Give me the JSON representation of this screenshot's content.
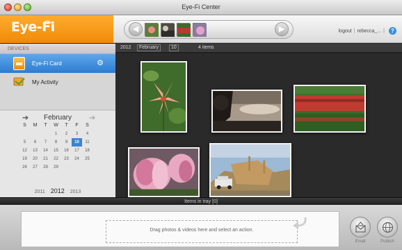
{
  "window": {
    "title": "Eye-Fi Center"
  },
  "brand": {
    "logo": "Eye-Fi",
    "color": "#f39a1b"
  },
  "header": {
    "logout": "logout",
    "user": "rebecca_...",
    "help": "?"
  },
  "sidebar": {
    "section": "DEVICES",
    "items": [
      {
        "label": "Eye-Fi Card",
        "icon": "eyefi-card-icon"
      },
      {
        "label": "My Activity",
        "icon": "activity-icon"
      }
    ]
  },
  "calendar": {
    "month": "February",
    "weekdays": [
      "S",
      "M",
      "T",
      "W",
      "T",
      "F",
      "S"
    ],
    "days": [
      "",
      "",
      "",
      "1",
      "2",
      "3",
      "4",
      "5",
      "6",
      "7",
      "8",
      "9",
      "10",
      "11",
      "12",
      "13",
      "14",
      "15",
      "16",
      "17",
      "18",
      "19",
      "20",
      "21",
      "22",
      "23",
      "24",
      "25",
      "26",
      "27",
      "28",
      "29",
      "",
      "",
      ""
    ],
    "selected": "10",
    "years": [
      "2011",
      "2012",
      "2013"
    ]
  },
  "toolbar": {
    "year": "2012",
    "month": "February",
    "day": "10",
    "count": "4 items"
  },
  "tray": {
    "label": "Items in tray [0]"
  },
  "dropzone": {
    "text": "Drag photos & videos here and select an action."
  },
  "actions": [
    {
      "label": "Email"
    },
    {
      "label": "Publish"
    }
  ]
}
